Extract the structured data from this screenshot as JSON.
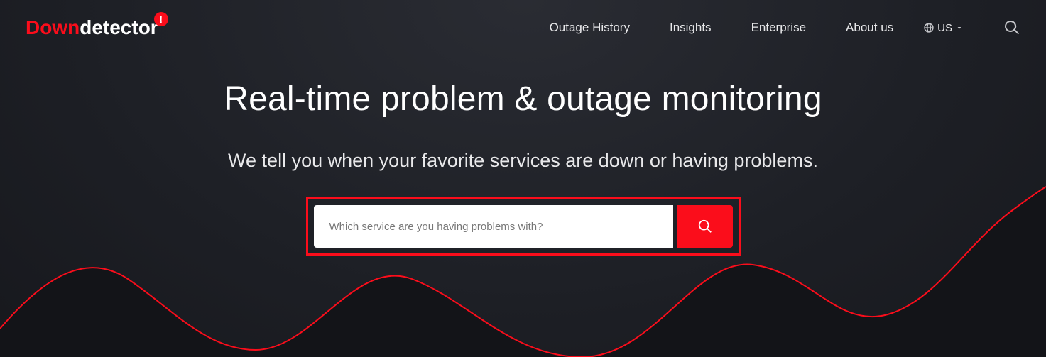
{
  "logo": {
    "part1": "Down",
    "part2": "detector",
    "badge": "!"
  },
  "nav": {
    "items": [
      {
        "label": "Outage History"
      },
      {
        "label": "Insights"
      },
      {
        "label": "Enterprise"
      },
      {
        "label": "About us"
      }
    ],
    "region": "US"
  },
  "hero": {
    "title": "Real-time problem & outage monitoring",
    "subtitle": "We tell you when your favorite services are down or having problems."
  },
  "search": {
    "placeholder": "Which service are you having problems with?"
  }
}
